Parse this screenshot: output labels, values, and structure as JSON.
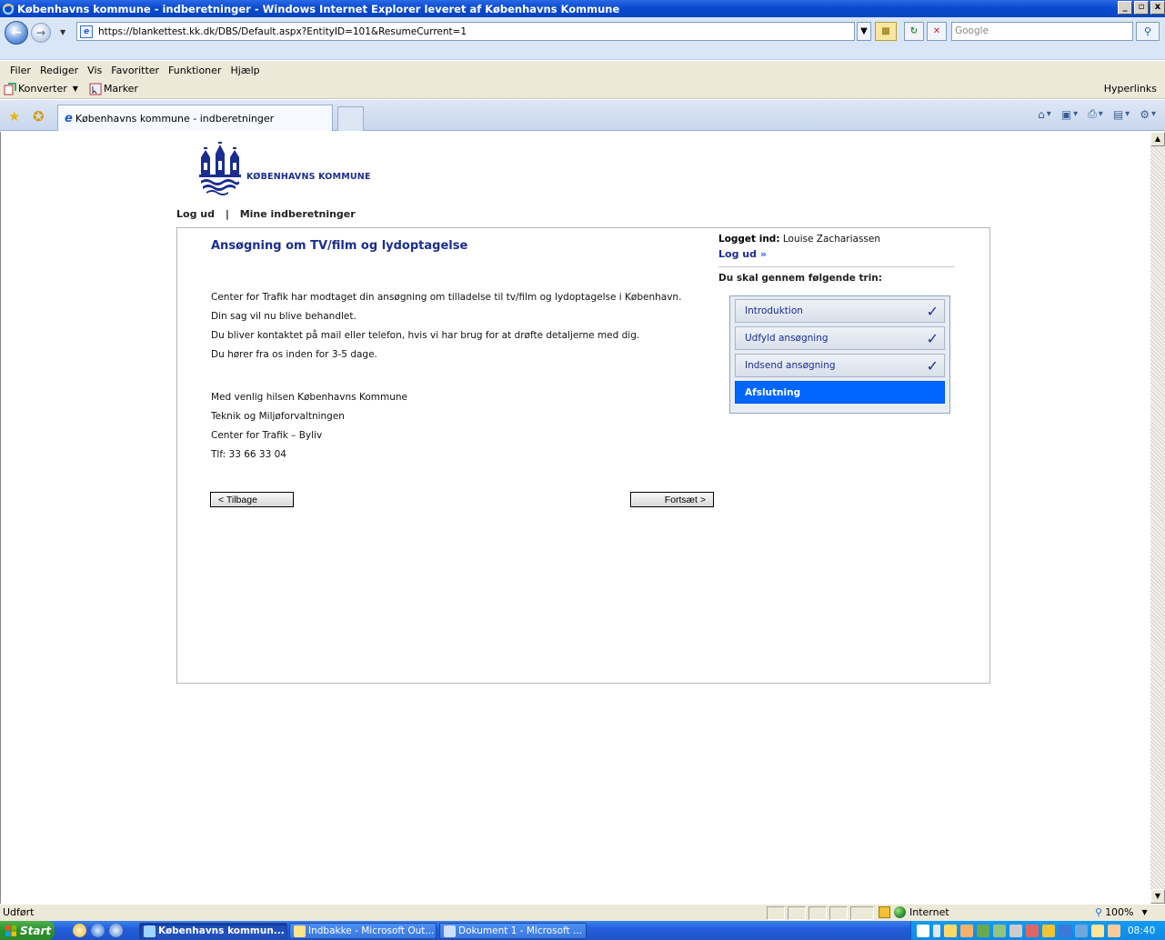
{
  "window": {
    "title": "Københavns kommune - indberetninger - Windows Internet Explorer leveret af Københavns Kommune",
    "controls": [
      "_",
      "▫",
      "x"
    ]
  },
  "address": {
    "url": "https://blankettest.kk.dk/DBS/Default.aspx?EntityID=101&ResumeCurrent=1",
    "search_placeholder": "Google"
  },
  "menu": [
    "Filer",
    "Rediger",
    "Vis",
    "Favoritter",
    "Funktioner",
    "Hjælp"
  ],
  "toolbar2": {
    "convert_label": "Konverter",
    "select_label": "Marker",
    "hyperlinks_label": "Hyperlinks"
  },
  "tab": {
    "title": "Københavns kommune - indberetninger"
  },
  "page": {
    "logo_text": "KØBENHAVNS KOMMUNE",
    "nav": {
      "logout": "Log ud",
      "separator": "|",
      "my_reports": "Mine indberetninger"
    },
    "form_title": "Ansøgning om TV/film og lydoptagelse",
    "body_lines": [
      "Center for Trafik har modtaget din ansøgning om tilladelse til tv/film og lydoptagelse i København.",
      "Din sag vil nu blive behandlet.",
      "Du bliver kontaktet på mail eller telefon, hvis vi har brug for at drøfte detaljerne med dig.",
      "Du hører fra os inden for 3-5 dage."
    ],
    "signature_lines": [
      "Med venlig hilsen Københavns Kommune",
      "Teknik og Miljøforvaltningen",
      "Center for Trafik – Byliv",
      "Tlf: 33 66 33 04"
    ],
    "back_button": "< Tilbage",
    "next_button": "Fortsæt >",
    "logged_in_label": "Logget ind:",
    "logged_in_user": "Louise Zachariassen",
    "logout_link": "Log ud",
    "logout_arrows": "»",
    "steps_heading": "Du skal gennem følgende trin:",
    "steps": [
      {
        "label": "Introduktion",
        "check": "✓"
      },
      {
        "label": "Udfyld ansøgning",
        "check": "✓"
      },
      {
        "label": "Indsend ansøgning",
        "check": "✓"
      },
      {
        "label": "Afslutning",
        "check": ""
      }
    ]
  },
  "status": {
    "text": "Udført",
    "zone": "Internet",
    "zoom": "100%"
  },
  "taskbar": {
    "start": "Start",
    "buttons": [
      "Københavns kommun...",
      "Indbakke - Microsoft Out...",
      "Dokument 1 - Microsoft ..."
    ],
    "clock": "08:40"
  },
  "colors": {
    "brand": "#1b2d8f",
    "active_step": "#0066ff",
    "titlebar": "#0a4ad0"
  }
}
